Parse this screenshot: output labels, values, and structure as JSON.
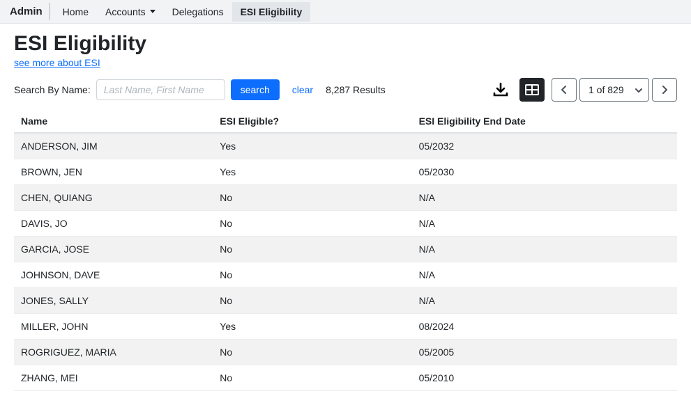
{
  "navbar": {
    "admin": "Admin",
    "items": [
      {
        "label": "Home"
      },
      {
        "label": "Accounts",
        "hasDropdown": true
      },
      {
        "label": "Delegations"
      },
      {
        "label": "ESI Eligibility",
        "active": true
      }
    ]
  },
  "header": {
    "title": "ESI Eligibility",
    "sublink": "see more about ESI"
  },
  "search": {
    "label": "Search By Name:",
    "placeholder": "Last Name, First Name",
    "button": "search",
    "clear": "clear",
    "results": "8,287 Results"
  },
  "pagination": {
    "label": "1 of 829"
  },
  "table": {
    "columns": [
      "Name",
      "ESI Eligible?",
      "ESI Eligibility End Date"
    ],
    "rows": [
      {
        "name": "ANDERSON, JIM",
        "eligible": "Yes",
        "end": "05/2032"
      },
      {
        "name": "BROWN, JEN",
        "eligible": "Yes",
        "end": "05/2030"
      },
      {
        "name": "CHEN, QUIANG",
        "eligible": "No",
        "end": "N/A"
      },
      {
        "name": "DAVIS, JO",
        "eligible": "No",
        "end": "N/A"
      },
      {
        "name": "GARCIA, JOSE",
        "eligible": "No",
        "end": "N/A"
      },
      {
        "name": "JOHNSON, DAVE",
        "eligible": "No",
        "end": "N/A"
      },
      {
        "name": "JONES, SALLY",
        "eligible": "No",
        "end": "N/A"
      },
      {
        "name": "MILLER, JOHN",
        "eligible": "Yes",
        "end": "08/2024"
      },
      {
        "name": "ROGRIGUEZ, MARIA",
        "eligible": "No",
        "end": "05/2005"
      },
      {
        "name": "ZHANG, MEI",
        "eligible": "No",
        "end": "05/2010"
      }
    ]
  }
}
